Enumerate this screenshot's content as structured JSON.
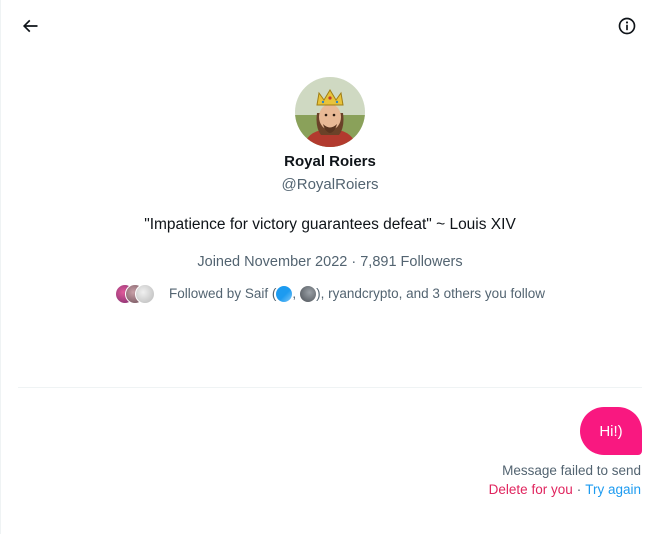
{
  "header": {
    "back_icon": "arrow-left-icon",
    "info_icon": "info-circle-icon"
  },
  "profile": {
    "display_name": "Royal Roiers",
    "handle": "@RoyalRoiers",
    "bio": "\"Impatience for victory guarantees defeat\" ~ Louis XIV",
    "joined": "Joined November 2022",
    "separator": "·",
    "followers": "7,891 Followers",
    "followed_by_prefix": "Followed by Saif (",
    "followed_by_comma": ",",
    "followed_by_suffix": "), ryandcrypto, and 3 others you follow"
  },
  "conversation": {
    "message_text": "Hi!)",
    "error_text": "Message failed to send",
    "delete_label": "Delete for you",
    "separator": "·",
    "retry_label": "Try again"
  },
  "colors": {
    "accent_pink": "#f91880",
    "link_blue": "#1d9bf0",
    "muted": "#536471"
  }
}
